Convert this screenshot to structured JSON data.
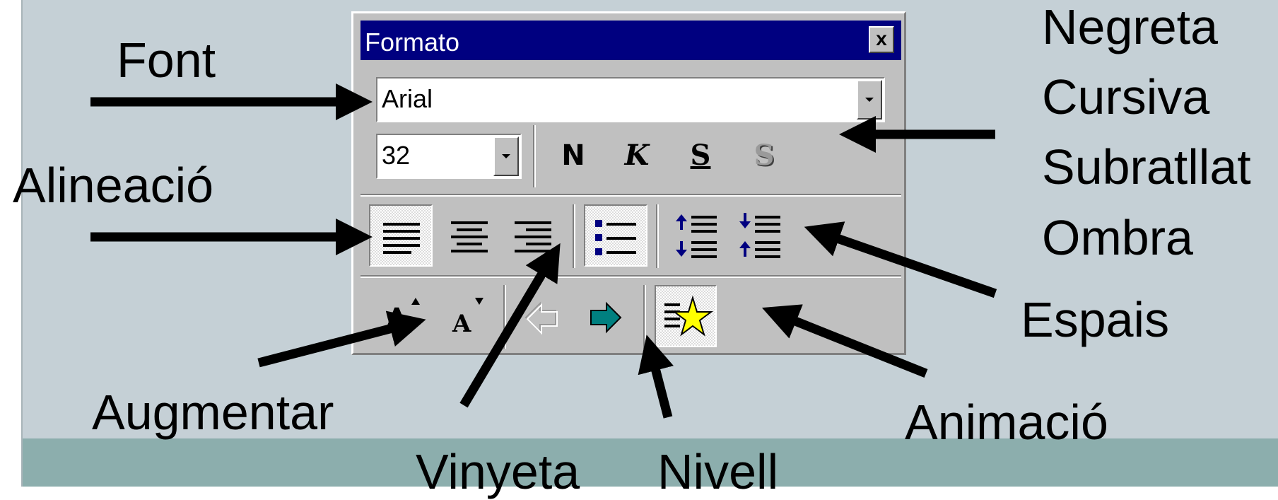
{
  "toolbar": {
    "title": "Formato",
    "close_label": "x",
    "font_name": "Arial",
    "font_size": "32",
    "format_buttons": {
      "bold": "N",
      "italic": "K",
      "underline": "S",
      "shadow": "S"
    }
  },
  "labels": {
    "font": "Font",
    "alineacio": "Alineació",
    "augmentar": "Augmentar",
    "vinyeta": "Vinyeta",
    "nivell": "Nivell",
    "animacio": "Animació",
    "espais": "Espais",
    "negreta": "Negreta",
    "cursiva": "Cursiva",
    "subratllat": "Subratllat",
    "ombra": "Ombra"
  },
  "icons": [
    "close-icon",
    "dropdown-arrow-icon",
    "align-left-icon",
    "align-center-icon",
    "align-right-icon",
    "bullet-list-icon",
    "increase-spacing-icon",
    "decrease-spacing-icon",
    "increase-font-icon",
    "decrease-font-icon",
    "promote-arrow-icon",
    "demote-arrow-icon",
    "animation-star-icon"
  ],
  "colors": {
    "titlebar": "#000080",
    "toolbar": "#c0c0c0",
    "slide": "#c5d0d6",
    "band": "#8caead",
    "star": "#ffff00",
    "demote_arrow": "#008080"
  }
}
